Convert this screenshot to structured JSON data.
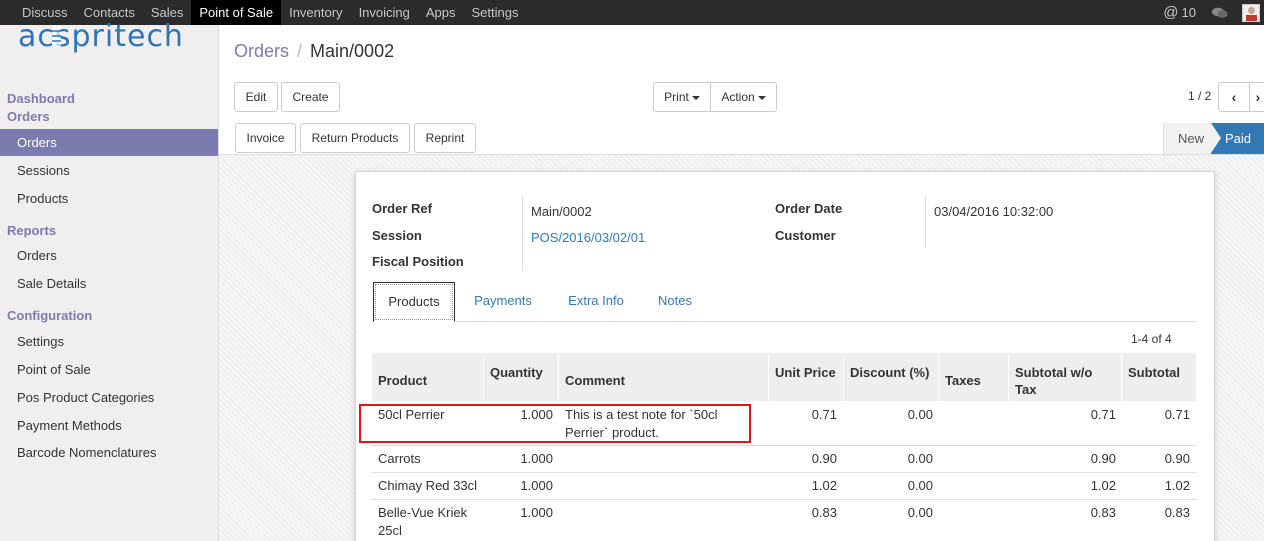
{
  "topbar": {
    "menu": [
      "Discuss",
      "Contacts",
      "Sales",
      "Point of Sale",
      "Inventory",
      "Invoicing",
      "Apps",
      "Settings"
    ],
    "active_menu": "Point of Sale",
    "mention_count": "10"
  },
  "logo": {
    "text": "acspritech"
  },
  "sidebar": {
    "dashboard": "Dashboard",
    "orders_head": "Orders",
    "orders_items": [
      "Orders",
      "Sessions",
      "Products"
    ],
    "reports_head": "Reports",
    "reports_items": [
      "Orders",
      "Sale Details"
    ],
    "config_head": "Configuration",
    "config_items": [
      "Settings",
      "Point of Sale",
      "Pos Product Categories",
      "Payment Methods",
      "Barcode Nomenclatures"
    ]
  },
  "breadcrumb": {
    "parent": "Orders",
    "current": "Main/0002"
  },
  "buttons": {
    "edit": "Edit",
    "create": "Create",
    "print": "Print",
    "action": "Action",
    "invoice": "Invoice",
    "return_products": "Return Products",
    "reprint": "Reprint"
  },
  "pager": {
    "value": "1 / 2"
  },
  "status": {
    "new": "New",
    "paid": "Paid"
  },
  "form": {
    "order_ref_label": "Order Ref",
    "order_ref": "Main/0002",
    "session_label": "Session",
    "session": "POS/2016/03/02/01",
    "fiscal_label": "Fiscal Position",
    "order_date_label": "Order Date",
    "order_date": "03/04/2016 10:32:00",
    "customer_label": "Customer"
  },
  "tabs": [
    "Products",
    "Payments",
    "Extra Info",
    "Notes"
  ],
  "list": {
    "count": "1-4 of 4",
    "headers": {
      "product": "Product",
      "quantity": "Quantity",
      "comment": "Comment",
      "unit_price": "Unit Price",
      "discount": "Discount (%)",
      "taxes": "Taxes",
      "subtotal_wo_tax_1": "Subtotal w/o",
      "subtotal_wo_tax_2": "Tax",
      "subtotal": "Subtotal"
    },
    "rows": [
      {
        "product": "50cl Perrier",
        "quantity": "1.000",
        "comment_1": "This is a test note for `50cl",
        "comment_2": "Perrier` product.",
        "unit_price": "0.71",
        "discount": "0.00",
        "subtotal_wo_tax": "0.71",
        "subtotal": "0.71"
      },
      {
        "product": "Carrots",
        "quantity": "1.000",
        "unit_price": "0.90",
        "discount": "0.00",
        "subtotal_wo_tax": "0.90",
        "subtotal": "0.90"
      },
      {
        "product": "Chimay Red 33cl",
        "quantity": "1.000",
        "unit_price": "1.02",
        "discount": "0.00",
        "subtotal_wo_tax": "1.02",
        "subtotal": "1.02"
      },
      {
        "product_1": "Belle-Vue Kriek",
        "product_2": "25cl",
        "quantity": "1.000",
        "unit_price": "0.83",
        "discount": "0.00",
        "subtotal_wo_tax": "0.83",
        "subtotal": "0.83"
      }
    ]
  },
  "colors": {
    "topbar": "#2b2b2b",
    "accent": "#7c7bad",
    "link": "#337ab7",
    "paid": "#3079b4",
    "highlight": "#e3121a"
  }
}
